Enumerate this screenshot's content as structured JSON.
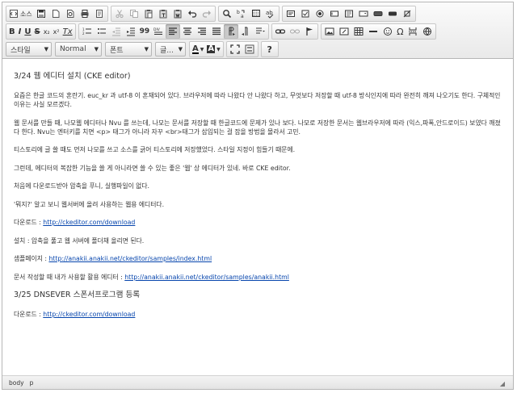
{
  "toolbar": {
    "row1": [
      {
        "group": "document",
        "items": [
          {
            "icon": "source-icon",
            "label": "소스",
            "name": "source-button"
          },
          {
            "icon": "save-icon",
            "name": "save-button"
          },
          {
            "icon": "new-page-icon",
            "name": "new-page-button"
          },
          {
            "icon": "preview-icon",
            "name": "preview-button"
          },
          {
            "icon": "print-icon",
            "name": "print-button"
          },
          {
            "icon": "templates-icon",
            "name": "templates-button"
          }
        ]
      },
      {
        "group": "clipboard",
        "items": [
          {
            "icon": "cut-icon",
            "name": "cut-button",
            "disabled": true
          },
          {
            "icon": "copy-icon",
            "name": "copy-button",
            "disabled": true
          },
          {
            "icon": "paste-icon",
            "name": "paste-button"
          },
          {
            "icon": "paste-text-icon",
            "name": "paste-text-button"
          },
          {
            "icon": "paste-word-icon",
            "name": "paste-word-button"
          },
          {
            "icon": "undo-icon",
            "name": "undo-button"
          },
          {
            "icon": "redo-icon",
            "name": "redo-button",
            "disabled": true
          }
        ]
      },
      {
        "group": "editing",
        "items": [
          {
            "icon": "find-icon",
            "name": "find-button"
          },
          {
            "icon": "replace-icon",
            "name": "replace-button"
          },
          {
            "icon": "select-all-icon",
            "name": "select-all-button"
          },
          {
            "icon": "spellcheck-icon",
            "name": "spellcheck-button"
          }
        ]
      },
      {
        "group": "forms",
        "items": [
          {
            "icon": "form-icon",
            "name": "form-button"
          },
          {
            "icon": "checkbox-icon",
            "name": "checkbox-button"
          },
          {
            "icon": "radio-icon",
            "name": "radio-button"
          },
          {
            "icon": "textfield-icon",
            "name": "textfield-button"
          },
          {
            "icon": "textarea-icon",
            "name": "textarea-button"
          },
          {
            "icon": "select-icon",
            "name": "select-button"
          },
          {
            "icon": "button-icon",
            "name": "button-button"
          },
          {
            "icon": "image-button-icon",
            "name": "image-button-button"
          },
          {
            "icon": "hidden-field-icon",
            "name": "hidden-field-button"
          }
        ]
      }
    ],
    "row2": [
      {
        "group": "basicstyles",
        "items": [
          {
            "icon": "bold-icon",
            "label": "B",
            "name": "bold-button"
          },
          {
            "icon": "italic-icon",
            "label": "I",
            "name": "italic-button"
          },
          {
            "icon": "underline-icon",
            "label": "U",
            "name": "underline-button"
          },
          {
            "icon": "strike-icon",
            "label": "S",
            "name": "strike-button"
          },
          {
            "icon": "subscript-icon",
            "label": "x₂",
            "name": "subscript-button"
          },
          {
            "icon": "superscript-icon",
            "label": "x²",
            "name": "superscript-button"
          },
          {
            "icon": "remove-format-icon",
            "label": "Tx",
            "name": "remove-format-button"
          }
        ]
      },
      {
        "group": "paragraph",
        "items": [
          {
            "icon": "numbered-list-icon",
            "name": "numbered-list-button"
          },
          {
            "icon": "bulleted-list-icon",
            "name": "bulleted-list-button"
          },
          {
            "icon": "outdent-icon",
            "name": "outdent-button",
            "disabled": true
          },
          {
            "icon": "indent-icon",
            "name": "indent-button"
          },
          {
            "icon": "blockquote-icon",
            "label": "99",
            "name": "blockquote-button"
          },
          {
            "icon": "div-icon",
            "name": "div-button"
          },
          {
            "icon": "align-left-icon",
            "name": "align-left-button",
            "active": true
          },
          {
            "icon": "align-center-icon",
            "name": "align-center-button"
          },
          {
            "icon": "align-right-icon",
            "name": "align-right-button"
          },
          {
            "icon": "align-justify-icon",
            "name": "align-justify-button"
          },
          {
            "icon": "ltr-icon",
            "name": "ltr-button",
            "active": true
          },
          {
            "icon": "rtl-icon",
            "name": "rtl-button"
          },
          {
            "icon": "language-icon",
            "name": "language-button"
          }
        ]
      },
      {
        "group": "links",
        "items": [
          {
            "icon": "link-icon",
            "name": "link-button"
          },
          {
            "icon": "unlink-icon",
            "name": "unlink-button",
            "disabled": true
          },
          {
            "icon": "anchor-icon",
            "name": "anchor-button"
          }
        ]
      },
      {
        "group": "insert",
        "items": [
          {
            "icon": "image-icon",
            "name": "image-button"
          },
          {
            "icon": "flash-icon",
            "name": "flash-button"
          },
          {
            "icon": "table-icon",
            "name": "table-button"
          },
          {
            "icon": "horizontal-rule-icon",
            "name": "horizontal-rule-button"
          },
          {
            "icon": "smiley-icon",
            "name": "smiley-button"
          },
          {
            "icon": "special-char-icon",
            "label": "Ω",
            "name": "special-char-button"
          },
          {
            "icon": "page-break-icon",
            "name": "page-break-button"
          },
          {
            "icon": "iframe-icon",
            "name": "iframe-button"
          }
        ]
      }
    ],
    "styles_combo": "스타일",
    "format_combo": "Normal",
    "font_combo": "폰트",
    "size_combo": "글...",
    "help_label": "?"
  },
  "content": {
    "paragraphs": [
      {
        "text": "3/24 웹 에디터 설치 (CKE editor)",
        "title": true
      },
      {
        "text": "요즘은 한글 코드의 혼란기. euc_kr 과 utf-8 이 혼재되어 있다. 브라우저에 따라 나왔다 안 나왔다 하고, 무엇보다 저장할 때 utf-8 방식인지에 따라 완전히 깨져 나오기도 한다. 구체적인 이유는 사실 모르겠다."
      },
      {
        "text": "웹 문서를 만들 때, 나모웹 에디터나 Nvu 를 쓰는데, 나모는 문서를 저장할 때 한글코드에 문제가 있나 보다. 나모로 저장한 문서는 웹브라우저에 따라 (익스,파폭,안드로이드) 보였다 깨졌다 한다.  Nvu는 엔터키를 치면 <p> 태그가 아니라 자꾸 <br>태그가 삽입되는 걸 잡을 방법을 몰라서 고민."
      },
      {
        "text": "티스토리에 글 쓸 때도 먼저 나모를 쓰고 소스를 긁어 티스토리에 저장했었다. 스타일 지정이 힘들기 때문에."
      },
      {
        "text": "그런데, 에디터의 복잡한 기능을 쓸 게 아니라면 쓸 수 있는 좋은 '웹' 상 에디터가 있네. 바로 CKE editor."
      },
      {
        "text": "처음에 다운로드받아 압축을 푸니, 실행파일이 없다."
      },
      {
        "text": "'뭐지?' 알고 보니 웹서버에 올려 사용하는 웹용 에디터다."
      },
      {
        "label": "다운로드 : ",
        "link": "http://ckeditor.com/download"
      },
      {
        "text": "설치 : 압축을 풀고 웹 서버에 폴더채 올리면 된다."
      },
      {
        "label": "샘플페이지 : ",
        "link": "http://anakii.anakii.net/ckeditor/samples/index.html"
      },
      {
        "label": "문서 작성할 때 내가 사용할 활용 에디터 : ",
        "link": "http://anakii.anakii.net/ckeditor/samples/anakii.html"
      },
      {
        "text": "3/25 DNSEVER 스폰서프로그램 등록",
        "title": true
      },
      {
        "label": "다운로드 : ",
        "link": "http://ckeditor.com/download"
      }
    ]
  },
  "statusbar": {
    "path": [
      "body",
      "p"
    ]
  }
}
